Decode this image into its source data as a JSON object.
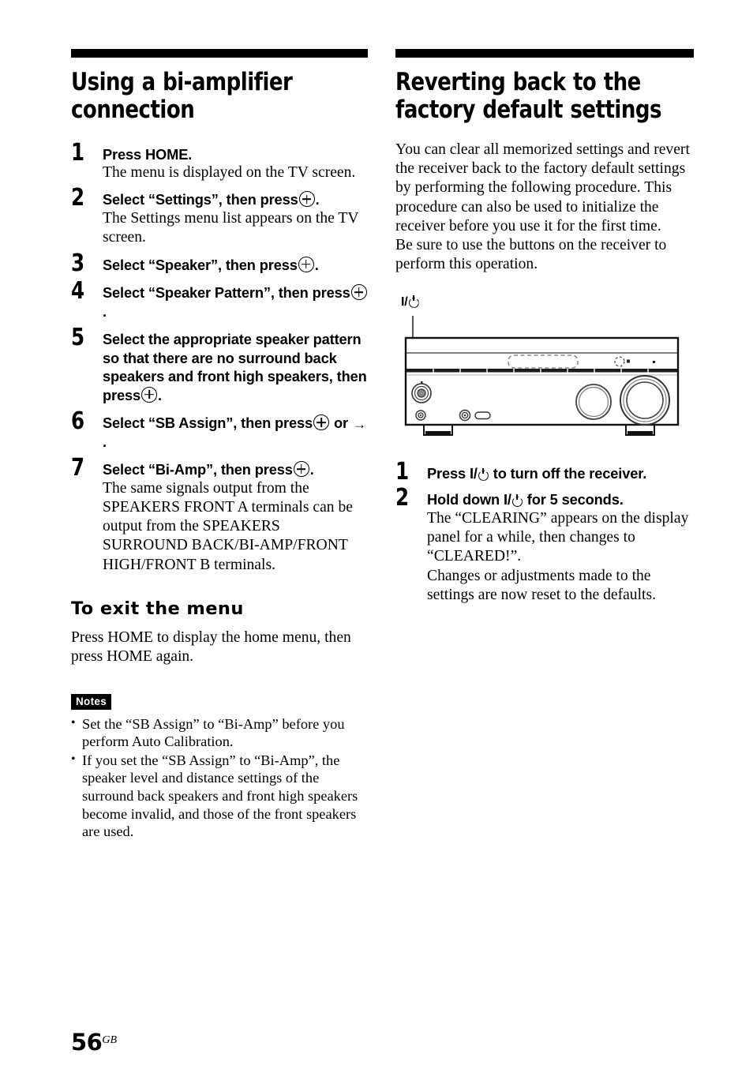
{
  "left_column": {
    "section_title": "Using a bi-amplifier connection",
    "steps": [
      {
        "num": "1",
        "lead_pre": "Press HOME.",
        "detail": "The menu is displayed on the TV screen."
      },
      {
        "num": "2",
        "lead_pre": "Select “Settings”, then press",
        "lead_post": ".",
        "detail": "The Settings menu list appears on the TV screen."
      },
      {
        "num": "3",
        "lead_pre": "Select “Speaker”, then press",
        "lead_post": ".",
        "detail": ""
      },
      {
        "num": "4",
        "lead_pre": "Select “Speaker Pattern”, then press",
        "lead_post": ".",
        "detail": ""
      },
      {
        "num": "5",
        "lead_pre": "Select the appropriate speaker pattern so that there are no surround back speakers and front high speakers, then press",
        "lead_post": ".",
        "detail": ""
      },
      {
        "num": "6",
        "lead_pre": "Select “SB Assign”, then press",
        "lead_mid": "or",
        "lead_post": ".",
        "detail": ""
      },
      {
        "num": "7",
        "lead_pre": "Select “Bi-Amp”, then press",
        "lead_post": ".",
        "detail": "The same signals output from the SPEAKERS FRONT A terminals can be output from the SPEAKERS SURROUND BACK/BI-AMP/FRONT HIGH/FRONT B terminals."
      }
    ],
    "exit_heading": "To exit the menu",
    "exit_text": "Press HOME to display the home menu, then press HOME again.",
    "notes_label": "Notes",
    "notes": [
      "Set the “SB Assign” to “Bi-Amp” before you perform Auto Calibration.",
      "If you set the “SB Assign” to “Bi-Amp”, the speaker level and distance settings of the surround back speakers and front high speakers become invalid, and those of the front speakers are used."
    ]
  },
  "right_column": {
    "section_title": "Reverting back to the factory default settings",
    "intro_paragraph_1": "You can clear all memorized settings and revert the receiver back to the factory default settings by performing the following procedure. This procedure can also be used to initialize the receiver before you use it for the first time.",
    "intro_paragraph_2": "Be sure to use the buttons on the receiver to perform this operation.",
    "figure": {
      "callout_label": "I/",
      "caption": ""
    },
    "steps": [
      {
        "num": "1",
        "lead_pre": "Press I/",
        "lead_post": "to turn off the receiver.",
        "detail": ""
      },
      {
        "num": "2",
        "lead_pre": "Hold down I/",
        "lead_post": "for 5 seconds.",
        "detail_1": "The “CLEARING” appears on the display panel for a while, then changes to “CLEARED!”.",
        "detail_2": "Changes or adjustments made to the settings are now reset to the defaults."
      }
    ]
  },
  "footer": {
    "page_number": "56",
    "region_code": "GB"
  },
  "icons": {
    "enter": "enter-button-icon",
    "arrow_right": "→",
    "power": "power-icon"
  }
}
